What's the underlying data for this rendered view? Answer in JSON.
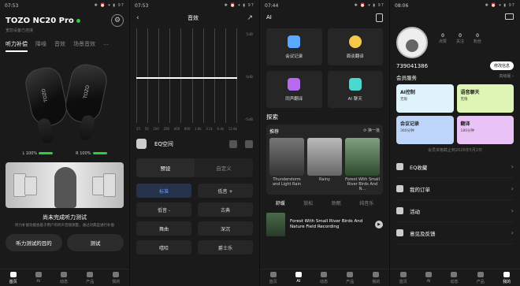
{
  "screen1": {
    "status_time": "07:53",
    "status_icons": "✱ ⏰ ▾ ▮ 97",
    "device_name": "TOZO NC20 Pro",
    "subtitle": "宽恕设备已连接",
    "tabs": [
      "听力补偿",
      "降噪",
      "音效",
      "场景音效",
      "…"
    ],
    "battery": {
      "left": "L 100%",
      "right": "R 100%"
    },
    "message": "尚未完成听力测试",
    "description": "听力补偿功能会基于用户的听声音频测量，通过对典型进行补偿",
    "btn_purpose": "听力测试的目的",
    "btn_test": "测试",
    "brand_left": "TOZO",
    "brand_right": "TOZO"
  },
  "screen2": {
    "status_time": "07:53",
    "status_icons": "✱ ⏰ ▾ ▮ 97",
    "title": "音效",
    "db_labels": [
      "5dB",
      "0dB",
      "-5dB"
    ],
    "freqs": [
      "25",
      "50",
      "100",
      "200",
      "400",
      "800",
      "1.6k",
      "3.2k",
      "6.4k",
      "12.8k"
    ],
    "eq_label": "EQ空间",
    "seg_preset": "预设",
    "seg_custom": "自定义",
    "presets": [
      "标准",
      "低音 +",
      "低音 -",
      "古典",
      "舞曲",
      "深沉",
      "嘻哈",
      "爵士乐"
    ]
  },
  "screen3": {
    "status_time": "07:44",
    "status_icons": "✱ ⏰ ▾ ▮ 97",
    "title": "AI",
    "cards": [
      "会议记录",
      "面谈翻译",
      "同声翻译",
      "AI 聊天"
    ],
    "explore": "探索",
    "recommend": "推荐",
    "refresh": "换一批",
    "thumbs": [
      "Thunderstorm and Light Rain",
      "Rainy",
      "Forest With Small River Birds And N..."
    ],
    "moods": [
      "舒缓",
      "放松",
      "助眠",
      "纯音乐"
    ],
    "track": "Forest With Small River Birds And Nature Field Recording"
  },
  "screen4": {
    "status_time": "08:06",
    "status_icons": "✱ ⏰ ▾ ▮ 97",
    "stats": [
      {
        "n": "0",
        "l": "点赞"
      },
      {
        "n": "0",
        "l": "关注"
      },
      {
        "n": "0",
        "l": "粉丝"
      }
    ],
    "uid": "739041386",
    "edit_label": "修改信息",
    "member_title": "会员服务",
    "member_level": "高级版 ›",
    "member_grid": [
      {
        "a": "AI控制",
        "b": "无限",
        "color": "#dff3fb"
      },
      {
        "a": "语音聊天",
        "b": "无限",
        "color": "#dff5b5"
      },
      {
        "a": "会议记录",
        "b": "360分钟",
        "color": "#bcd5f8"
      },
      {
        "a": "翻译",
        "b": "180分钟",
        "color": "#eac3f6"
      }
    ],
    "expire": "会员资格截止到2026年5月2日",
    "menu": [
      "EQ收藏",
      "我的订单",
      "活动",
      "意见及反馈"
    ]
  },
  "nav": [
    "首页",
    "AI",
    "动态",
    "产品",
    "我的"
  ]
}
